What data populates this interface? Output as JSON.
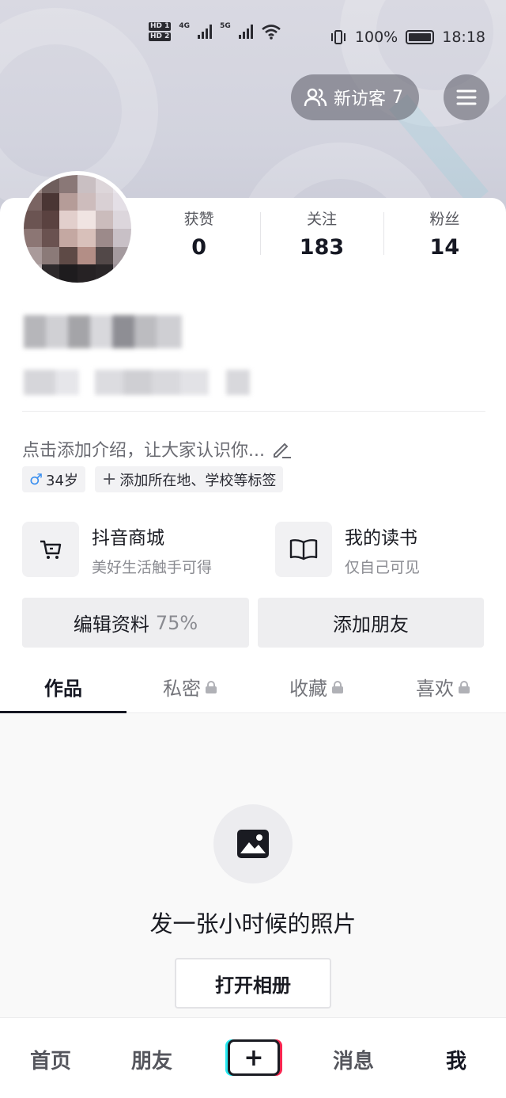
{
  "status_bar": {
    "sim_labels": [
      "HD 1",
      "HD 2"
    ],
    "net1": "4G",
    "net2": "5G",
    "battery": "100%",
    "time": "18:18"
  },
  "header": {
    "visitors_label": "新访客",
    "visitors_count": "7"
  },
  "stats": [
    {
      "label": "获赞",
      "value": "0"
    },
    {
      "label": "关注",
      "value": "183"
    },
    {
      "label": "粉丝",
      "value": "14"
    }
  ],
  "profile": {
    "bio_placeholder": "点击添加介绍，让大家认识你...",
    "gender_age": "34岁",
    "add_tags": "添加所在地、学校等标签"
  },
  "features": [
    {
      "title": "抖音商城",
      "subtitle": "美好生活触手可得",
      "icon": "cart-icon"
    },
    {
      "title": "我的读书",
      "subtitle": "仅自己可见",
      "icon": "book-icon"
    }
  ],
  "actions": {
    "edit_label": "编辑资料",
    "edit_percent": "75%",
    "add_friend_label": "添加朋友"
  },
  "tabs": [
    {
      "label": "作品",
      "locked": false,
      "active": true
    },
    {
      "label": "私密",
      "locked": true,
      "active": false
    },
    {
      "label": "收藏",
      "locked": true,
      "active": false
    },
    {
      "label": "喜欢",
      "locked": true,
      "active": false
    }
  ],
  "empty_state": {
    "text": "发一张小时候的照片",
    "button": "打开相册"
  },
  "bottom_nav": {
    "home": "首页",
    "friends": "朋友",
    "create": "+",
    "messages": "消息",
    "me": "我"
  }
}
